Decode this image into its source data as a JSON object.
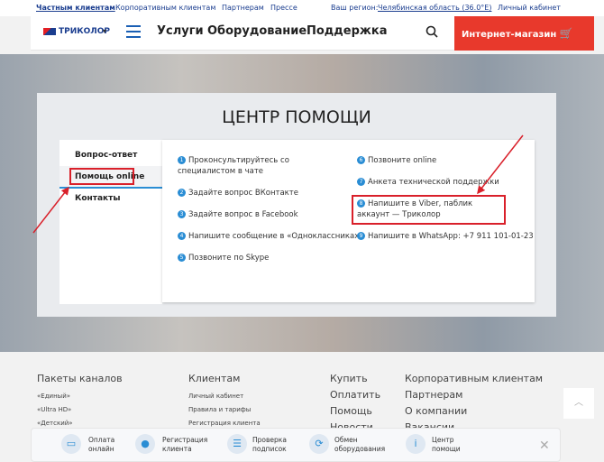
{
  "topbar": {
    "links": [
      "Частным клиентам",
      "Корпоративным клиентам",
      "Партнерам",
      "Прессе"
    ],
    "region_label": "Ваш регион:",
    "region_value": "Челябинская область (36.0°E)",
    "account": "Личный кабинет"
  },
  "header": {
    "logo": "ТРИКОЛОР",
    "nav": [
      "Услуги",
      "Оборудование",
      "Поддержка"
    ],
    "shop_button": "Интернет-магазин"
  },
  "help": {
    "title": "ЦЕНТР ПОМОЩИ",
    "sidebar": [
      "Вопрос-ответ",
      "Помощь online",
      "Контакты"
    ],
    "options_left": [
      {
        "n": "1",
        "text": "Проконсультируйтесь со специалистом в чате"
      },
      {
        "n": "2",
        "text": "Задайте вопрос ВКонтакте"
      },
      {
        "n": "3",
        "text": "Задайте вопрос в Facebook"
      },
      {
        "n": "4",
        "text": "Напишите сообщение в «Одноклассниках»"
      },
      {
        "n": "5",
        "text": "Позвоните по Skype"
      }
    ],
    "options_right": [
      {
        "n": "6",
        "text": "Позвоните online"
      },
      {
        "n": "7",
        "text": "Анкета технической поддержки"
      },
      {
        "n": "8",
        "text": "Напишите в Viber, паблик аккаунт — Триколор"
      },
      {
        "n": "9",
        "text": "Напишите в WhatsApp: +7 911 101-01-23"
      }
    ]
  },
  "footer": {
    "col1_title": "Пакеты каналов",
    "col1_items": [
      "«Единый»",
      "«Ultra HD»",
      "«Детский»"
    ],
    "col2_title": "Клиентам",
    "col2_items": [
      "Личный кабинет",
      "Правила и тарифы",
      "Регистрация клиента"
    ],
    "col3_items": [
      "Купить",
      "Оплатить",
      "Помощь",
      "Новости"
    ],
    "col4_items": [
      "Корпоративным клиентам",
      "Партнерам",
      "О компании",
      "Вакансии"
    ]
  },
  "bottom_bar": [
    {
      "icon": "card-icon",
      "label": "Оплата онлайн"
    },
    {
      "icon": "user-icon",
      "label": "Регистрация клиента"
    },
    {
      "icon": "list-icon",
      "label": "Проверка подписок"
    },
    {
      "icon": "exchange-icon",
      "label": "Обмен оборудования"
    },
    {
      "icon": "info-icon",
      "label": "Центр помощи"
    }
  ]
}
